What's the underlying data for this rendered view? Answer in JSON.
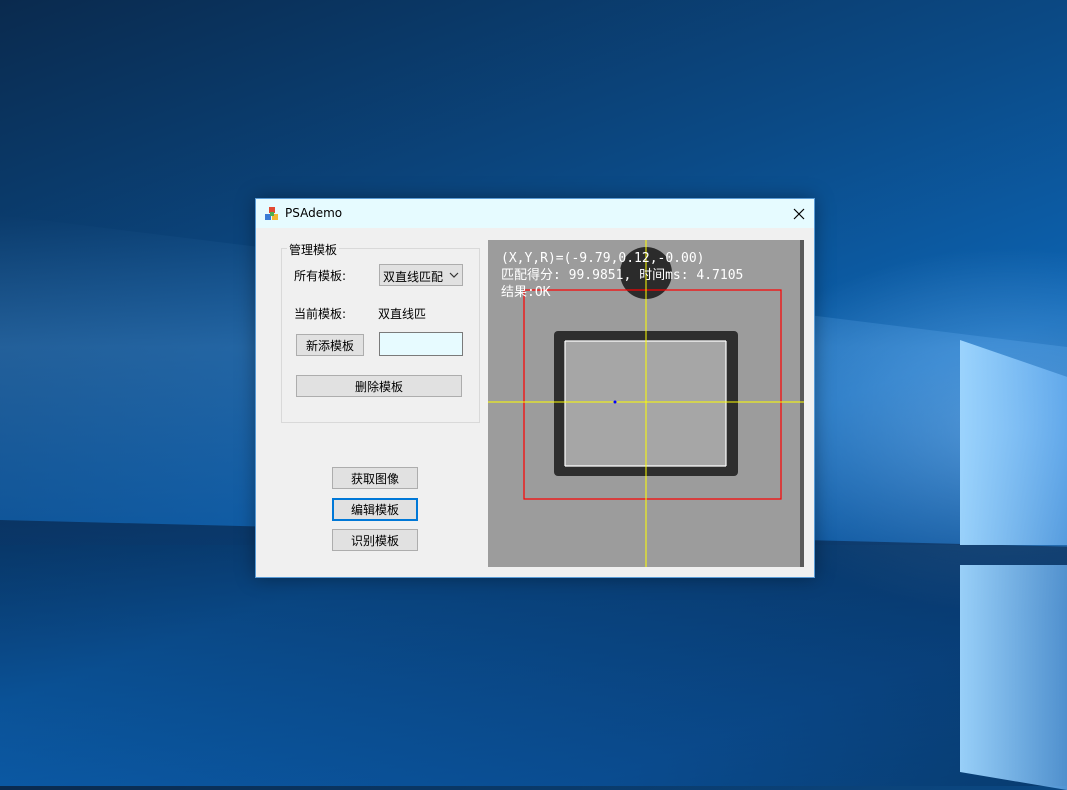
{
  "window": {
    "title": "PSAdemo"
  },
  "panel": {
    "group_title": "管理模板",
    "all_templates_label": "所有模板:",
    "all_templates_selected": "双直线匹配",
    "current_template_label": "当前模板:",
    "current_template_value": "双直线匹",
    "new_template_button": "新添模板",
    "new_template_name": "",
    "delete_template_button": "删除模板"
  },
  "actions": {
    "acquire_image_button": "获取图像",
    "edit_template_button": "编辑模板",
    "recognize_template_button": "识别模板"
  },
  "viewer": {
    "pose_text": "(X,Y,R)=(-9.79,0.12,-0.00)",
    "score_text": "匹配得分: 99.9851, 时间ms: 4.7105",
    "result_text": "结果:OK"
  },
  "icons": {
    "app": "app-icon",
    "close": "close-icon",
    "dropdown": "chevron-down-icon"
  },
  "colors": {
    "title_bar": "#e6fbff",
    "window_border": "#5a9bd5",
    "crosshair": "#ffff00",
    "roi_box": "#ff0000",
    "focus_border": "#0078d7"
  }
}
